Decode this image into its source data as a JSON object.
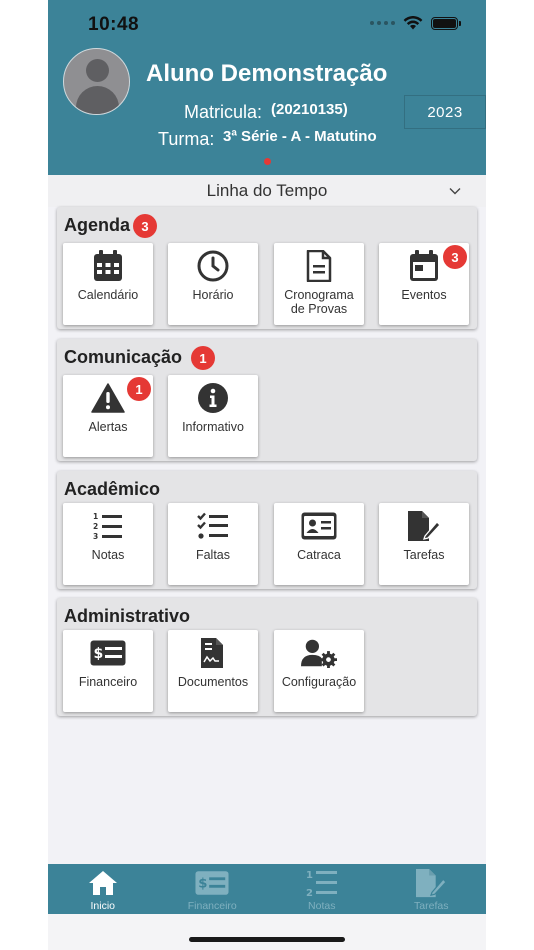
{
  "status_bar": {
    "time": "10:48"
  },
  "header": {
    "student_name": "Aluno Demonstração",
    "matricula_label": "Matricula:",
    "matricula_value": "(20210135)",
    "turma_label": "Turma:",
    "turma_value": "3ª Série - A - Matutino",
    "year": "2023"
  },
  "timeline": {
    "label": "Linha do Tempo"
  },
  "sections": {
    "agenda": {
      "title": "Agenda",
      "badge": "3",
      "tiles": [
        {
          "label": "Calendário",
          "icon": "calendar-grid-icon"
        },
        {
          "label": "Horário",
          "icon": "clock-icon"
        },
        {
          "label": "Cronograma de Provas",
          "icon": "document-icon"
        },
        {
          "label": "Eventos",
          "icon": "calendar-icon",
          "badge": "3"
        }
      ]
    },
    "comunicacao": {
      "title": "Comunicação",
      "badge": "1",
      "tiles": [
        {
          "label": "Alertas",
          "icon": "warning-icon",
          "badge": "1"
        },
        {
          "label": "Informativo",
          "icon": "info-icon"
        }
      ]
    },
    "academico": {
      "title": "Acadêmico",
      "tiles": [
        {
          "label": "Notas",
          "icon": "numbered-list-icon"
        },
        {
          "label": "Faltas",
          "icon": "checklist-icon"
        },
        {
          "label": "Catraca",
          "icon": "id-card-icon"
        },
        {
          "label": "Tarefas",
          "icon": "file-signature-icon"
        }
      ]
    },
    "administrativo": {
      "title": "Administrativo",
      "tiles": [
        {
          "label": "Financeiro",
          "icon": "money-bill-icon"
        },
        {
          "label": "Documentos",
          "icon": "file-contract-icon"
        },
        {
          "label": "Configuração",
          "icon": "user-gear-icon"
        }
      ]
    }
  },
  "tabbar": {
    "tabs": [
      {
        "label": "Inicio",
        "icon": "home-icon",
        "active": true
      },
      {
        "label": "Financeiro",
        "icon": "money-bill-icon"
      },
      {
        "label": "Notas",
        "icon": "numbered-list-icon"
      },
      {
        "label": "Tarefas",
        "icon": "file-signature-icon"
      }
    ]
  },
  "colors": {
    "primary": "#3c8398",
    "badge": "#e53935",
    "tab_inactive": "#7fb0bf"
  }
}
